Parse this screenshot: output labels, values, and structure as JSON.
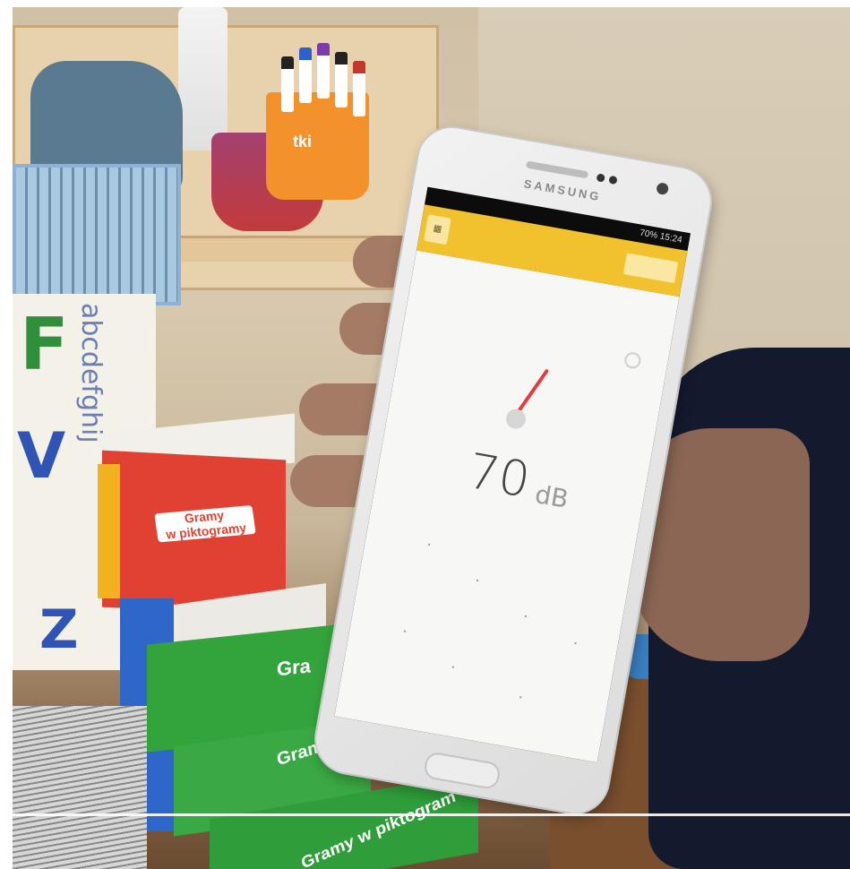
{
  "phone": {
    "brand": "SAMSUNG",
    "status": "70%  15:24",
    "app_title": "",
    "reading_value": "70",
    "reading_unit": "dB"
  },
  "scene": {
    "red_box": {
      "line1": "Gramy",
      "line2": "w piktogramy"
    },
    "green_box_1": "Gra",
    "green_box_2": "Gramy",
    "green_box_3": "Gramy w piktogram",
    "cup_label": "tki",
    "poster_letters": [
      "F",
      "V",
      "Z"
    ],
    "poster_strip": "abcdefghij"
  },
  "colors": {
    "appbar": "#f2c12e",
    "needle": "#e43b3b",
    "box_red": "#e14132",
    "box_green": "#33a43b"
  }
}
